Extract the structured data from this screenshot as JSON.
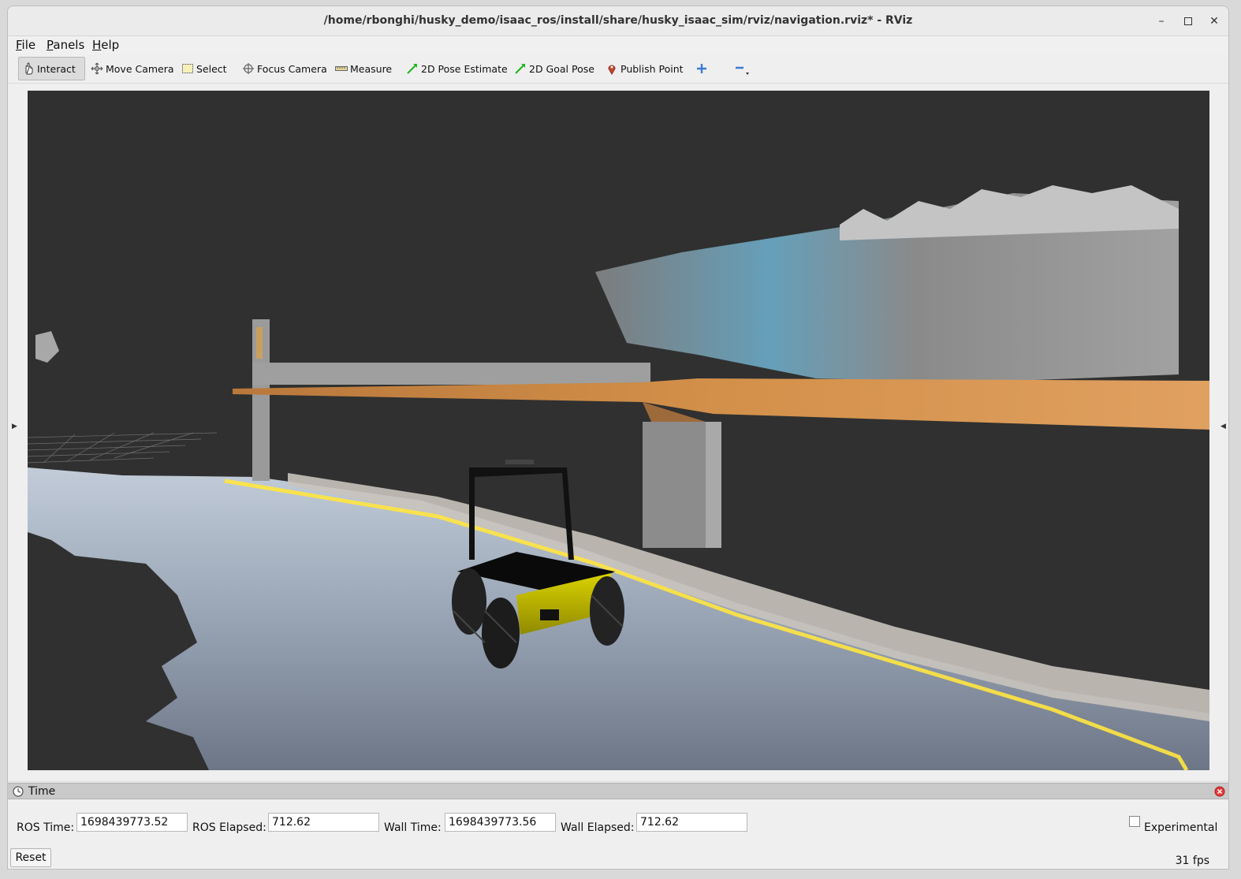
{
  "window": {
    "title": "/home/rbonghi/husky_demo/isaac_ros/install/share/husky_isaac_sim/rviz/navigation.rviz* - RViz",
    "minimize_symbol": "–",
    "maximize_symbol": "▫",
    "close_symbol": "✕"
  },
  "menu": {
    "file_u": "F",
    "file_rest": "ile",
    "panels_u": "P",
    "panels_rest": "anels",
    "help_u": "H",
    "help_rest": "elp"
  },
  "toolbar": {
    "interact": "Interact",
    "move_camera": "Move Camera",
    "select": "Select",
    "focus_camera": "Focus Camera",
    "measure": "Measure",
    "pose_estimate": "2D Pose Estimate",
    "goal_pose": "2D Goal Pose",
    "publish_point": "Publish Point",
    "add_tool_icon": "plus-icon",
    "remove_tool_icon": "minus-icon"
  },
  "viewport": {
    "background": "#303030",
    "robot_body_color": "#c8c200",
    "path_highlight_color": "#ffe640",
    "map_orange": "#d2904a",
    "map_blue": "#6fb3d2"
  },
  "time_panel": {
    "title": "Time",
    "ros_time_label": "ROS Time:",
    "ros_time_value": "1698439773.52",
    "ros_elapsed_label": "ROS Elapsed:",
    "ros_elapsed_value": "712.62",
    "wall_time_label": "Wall Time:",
    "wall_time_value": "1698439773.56",
    "wall_elapsed_label": "Wall Elapsed:",
    "wall_elapsed_value": "712.62",
    "experimental_label": "Experimental",
    "experimental_checked": false,
    "reset_label": "Reset",
    "fps": "31 fps"
  }
}
